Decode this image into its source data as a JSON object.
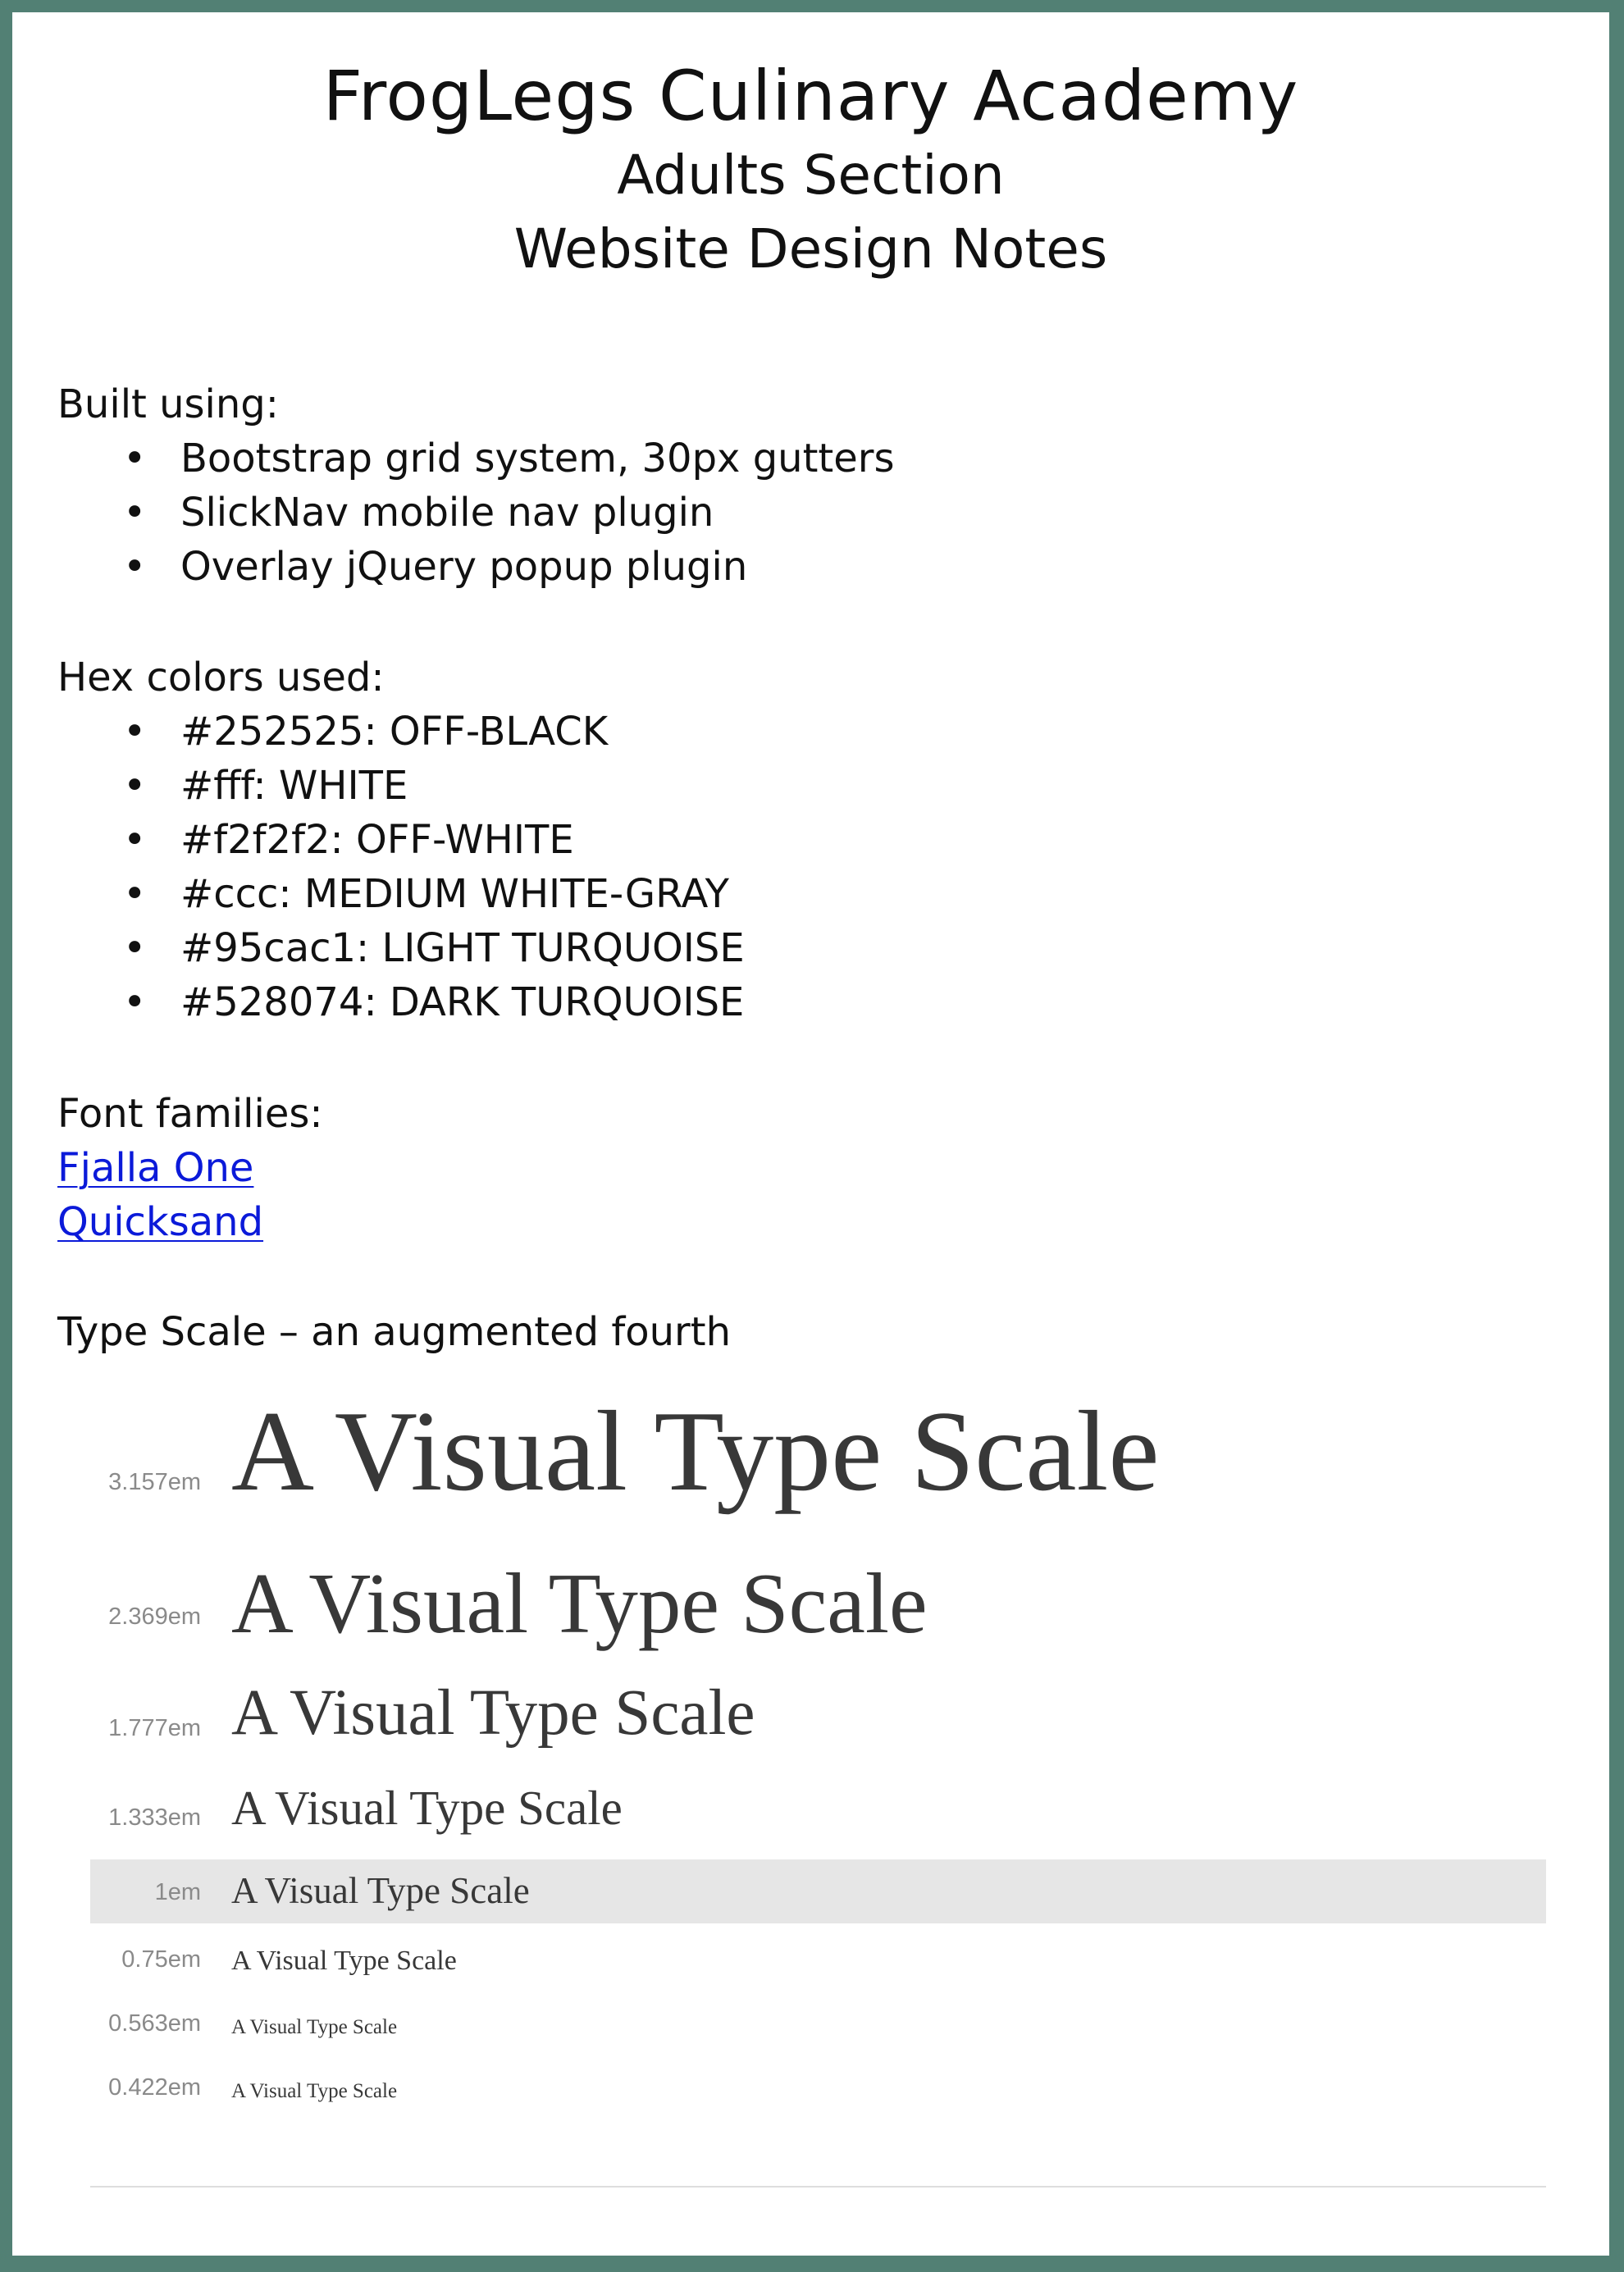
{
  "header": {
    "title": "FrogLegs Culinary Academy",
    "subtitle": "Adults Section",
    "subtitle2": "Website Design Notes"
  },
  "built_using": {
    "heading": "Built using:",
    "items": [
      "Bootstrap grid system, 30px gutters",
      "SlickNav mobile nav plugin",
      "Overlay jQuery popup plugin"
    ]
  },
  "hex_colors": {
    "heading": "Hex colors used:",
    "items": [
      "#252525: OFF-BLACK",
      "#fff: WHITE",
      "#f2f2f2: OFF-WHITE",
      "#ccc: MEDIUM WHITE-GRAY",
      "#95cac1: LIGHT TURQUOISE",
      "#528074: DARK TURQUOISE"
    ]
  },
  "fonts": {
    "heading": "Font families:",
    "links": [
      "Fjalla One",
      "Quicksand"
    ]
  },
  "type_scale": {
    "heading": "Type Scale – an augmented fourth",
    "sample_text": "A Visual Type Scale",
    "rows": [
      {
        "size": "3.157em"
      },
      {
        "size": "2.369em"
      },
      {
        "size": "1.777em"
      },
      {
        "size": "1.333em"
      },
      {
        "size": "1em",
        "highlighted": true
      },
      {
        "size": "0.75em"
      },
      {
        "size": "0.563em"
      },
      {
        "size": "0.422em"
      }
    ]
  },
  "colors": {
    "frame": "#528074",
    "link": "#0b1ad9",
    "highlight_row": "#e6e6e6",
    "em_label": "#8a8a8a"
  },
  "bullet_glyph": "•"
}
